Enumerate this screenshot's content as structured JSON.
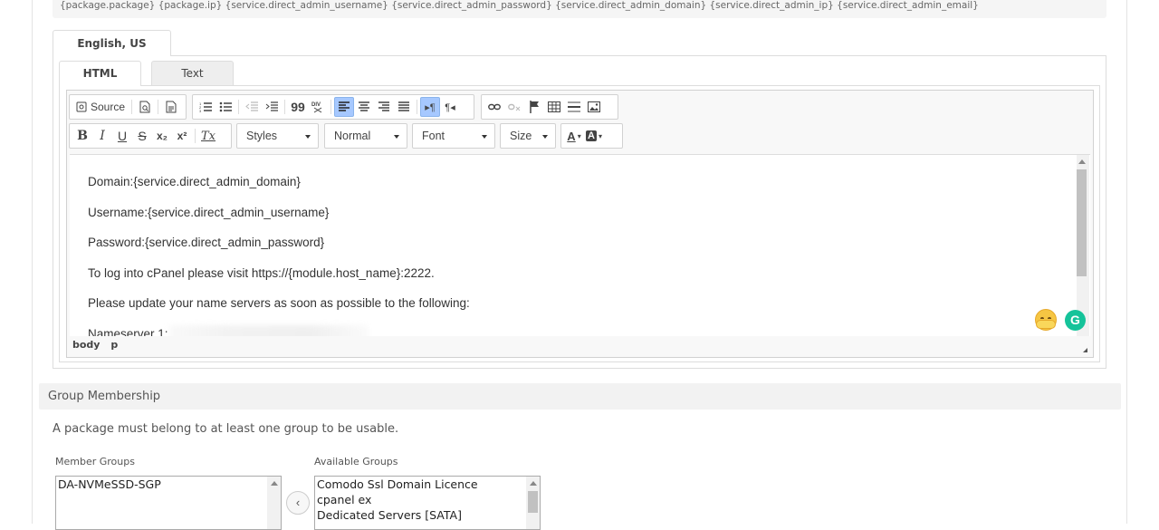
{
  "merge_tags": "{package.package} {package.ip} {service.direct_admin_username} {service.direct_admin_password} {service.direct_admin_domain} {service.direct_admin_ip} {service.direct_admin_email}",
  "language_tab": "English, US",
  "mode_tabs": {
    "html": "HTML",
    "text": "Text"
  },
  "toolbar": {
    "source_label": "Source",
    "styles": "Styles",
    "format": "Normal",
    "font": "Font",
    "size": "Size",
    "font_color_label": "A",
    "bg_color_label": "A",
    "bold": "B",
    "italic": "I",
    "underline": "U",
    "strike": "S",
    "subscript": "x₂",
    "superscript": "x²",
    "remove_format": "Tx",
    "blockquote": "99",
    "bidi_ltr": "▸¶",
    "bidi_rtl": "¶◂"
  },
  "content": {
    "line1": "Domain:{service.direct_admin_domain}",
    "line2": "Username:{service.direct_admin_username}",
    "line3": "Password:{service.direct_admin_password}",
    "line4": "To log into cPanel please visit https://{module.host_name}:2222.",
    "line5": "Please update your name servers as soon as possible to the following:",
    "line6": "Nameserver 1: "
  },
  "pathbar": {
    "body": "body",
    "p": "p"
  },
  "group_membership": {
    "title": "Group Membership",
    "help": "A package must belong to at least one group to be usable.",
    "member_label": "Member Groups",
    "available_label": "Available Groups",
    "member_groups": [
      "DA-NVMeSSD-SGP"
    ],
    "available_groups": [
      "Comodo Ssl Domain Licence",
      "cpanel ex",
      "Dedicated Servers [SATA]"
    ],
    "move_button": "‹"
  },
  "colors": {
    "accent_active": "#a6c8ff",
    "grammarly": "#15c39a",
    "panel_bg": "#f2f2f2"
  }
}
